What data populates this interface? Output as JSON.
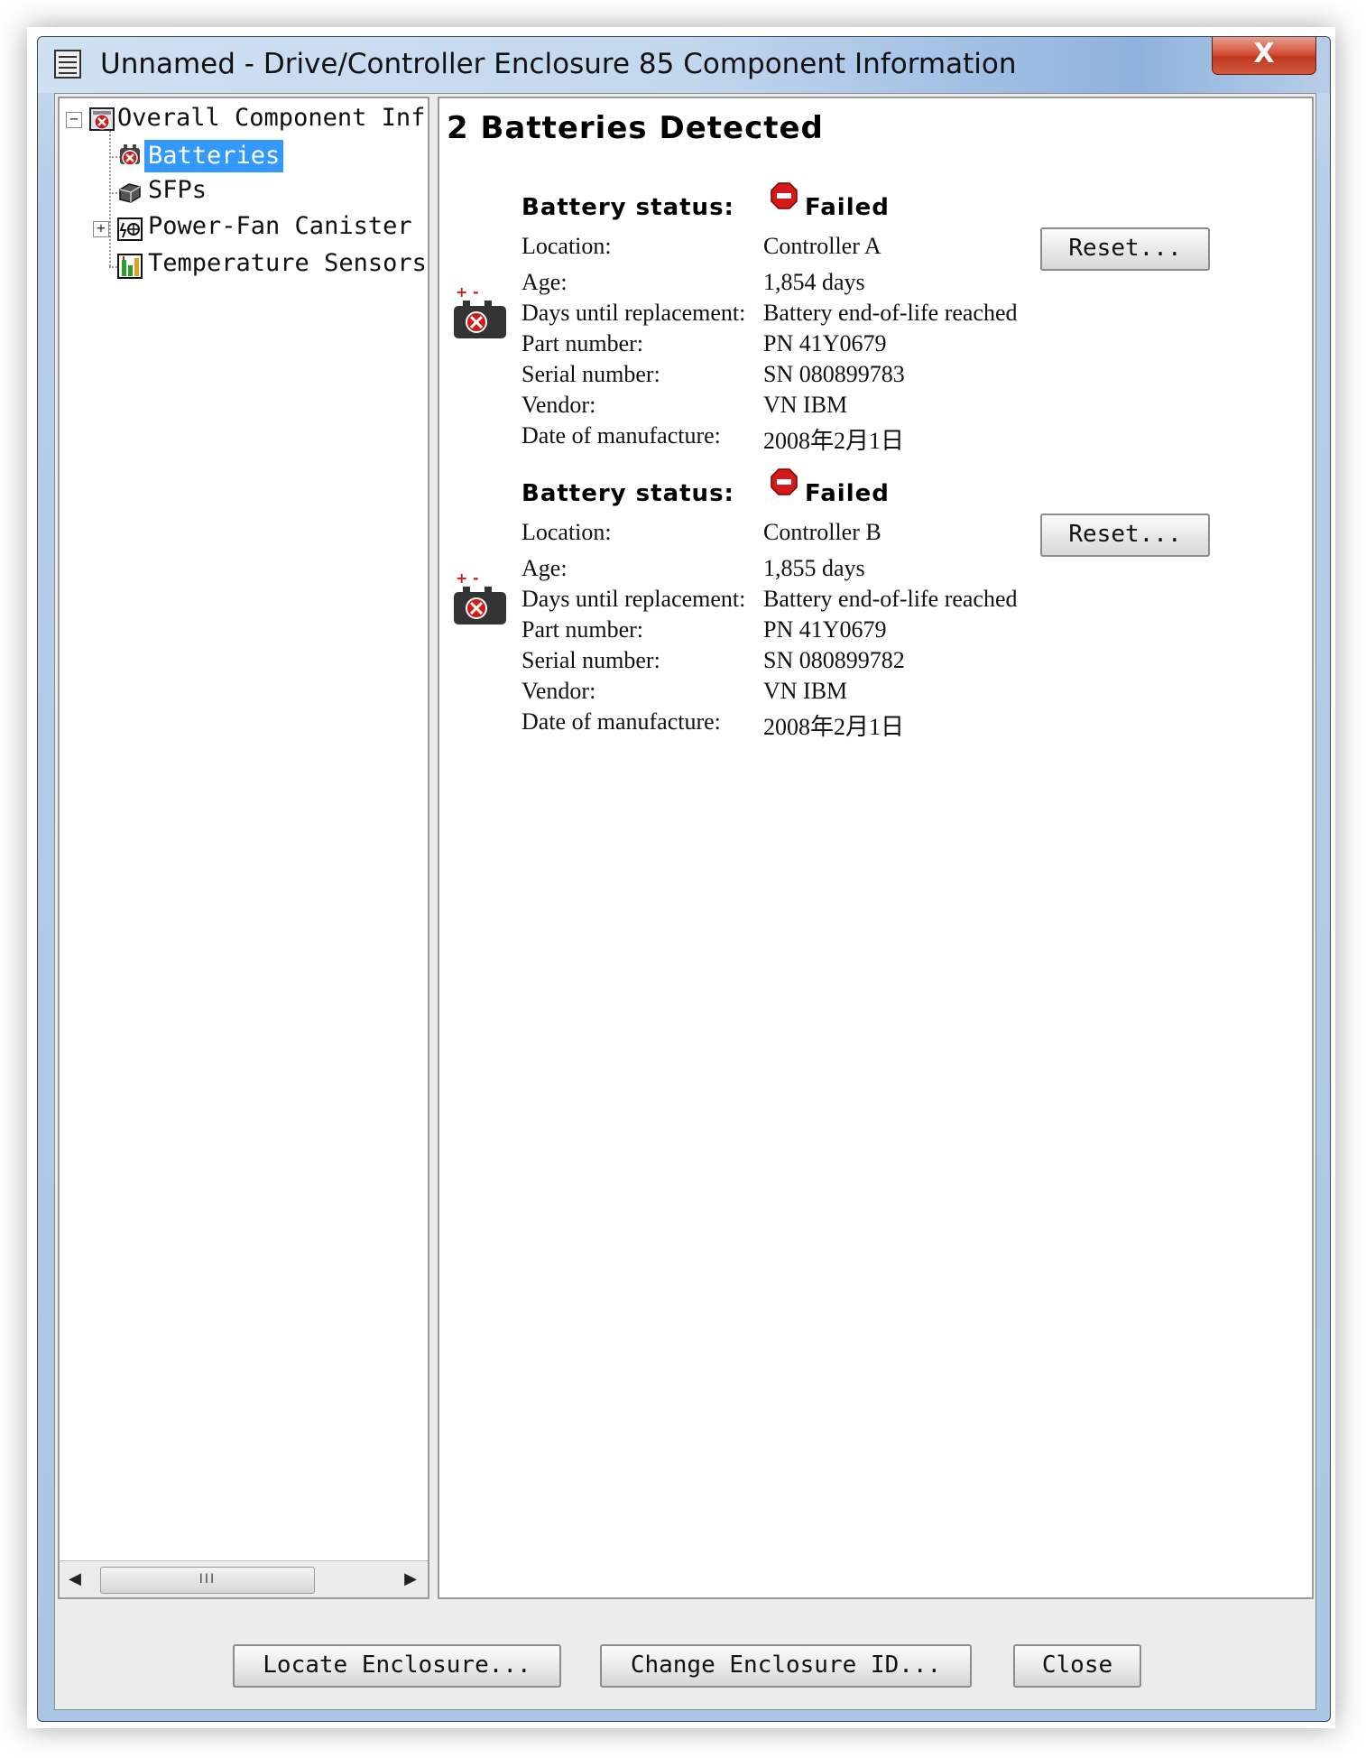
{
  "window": {
    "title": "Unnamed - Drive/Controller Enclosure 85 Component Information",
    "close_label": "X"
  },
  "tree": {
    "root": {
      "label": "Overall Component Inf",
      "icon": "component-failed-icon",
      "expanded": true
    },
    "items": [
      {
        "label": "Batteries",
        "icon": "battery-failed-icon",
        "selected": true
      },
      {
        "label": "SFPs",
        "icon": "sfp-icon",
        "selected": false
      },
      {
        "label": "Power-Fan Canister",
        "icon": "power-fan-icon",
        "selected": false,
        "expandable": true
      },
      {
        "label": "Temperature Sensors",
        "icon": "temperature-sensor-icon",
        "selected": false
      }
    ],
    "scrollbar_grip": "III"
  },
  "detail": {
    "heading": "2 Batteries Detected",
    "field_labels": {
      "status": "Battery status:",
      "location": "Location:",
      "age": "Age:",
      "days_until_replacement": "Days until replacement:",
      "part_number": "Part number:",
      "serial_number": "Serial number:",
      "vendor": "Vendor:",
      "date_of_manufacture": "Date of manufacture:"
    },
    "reset_label": "Reset...",
    "batteries": [
      {
        "status": "Failed",
        "location": "Controller A",
        "age": "1,854 days",
        "days_until_replacement": "Battery end-of-life reached",
        "part_number": "PN 41Y0679",
        "serial_number": "SN 080899783",
        "vendor": "VN IBM",
        "date_of_manufacture": "2008年2月1日"
      },
      {
        "status": "Failed",
        "location": "Controller B",
        "age": "1,855 days",
        "days_until_replacement": "Battery end-of-life reached",
        "part_number": "PN 41Y0679",
        "serial_number": "SN 080899782",
        "vendor": "VN IBM",
        "date_of_manufacture": "2008年2月1日"
      }
    ]
  },
  "buttons": {
    "locate": "Locate Enclosure...",
    "change_id": "Change Enclosure ID...",
    "close": "Close"
  },
  "colors": {
    "selection": "#3399ff",
    "failed": "#d21a1a",
    "close_button": "#c8452c"
  }
}
